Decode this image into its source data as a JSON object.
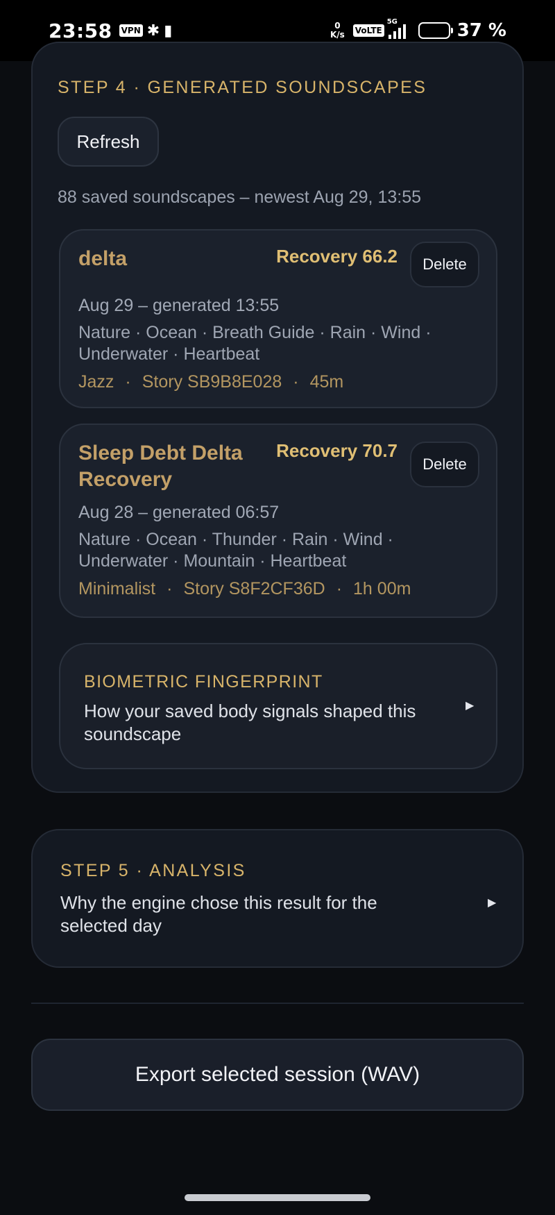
{
  "status_bar": {
    "time": "23:58",
    "vpn": "VPN",
    "speed_value": "0",
    "speed_unit": "K/s",
    "volte": "VoLTE",
    "network": "5G",
    "battery_percent": "37 %",
    "battery_level": 0.37
  },
  "step4": {
    "title": "STEP 4 · GENERATED SOUNDSCAPES",
    "refresh_label": "Refresh",
    "summary": "88 saved soundscapes – newest Aug 29, 13:55",
    "soundscapes": [
      {
        "title": "delta",
        "recovery": "Recovery 66.2",
        "delete_label": "Delete",
        "date": "Aug 29 – generated 13:55",
        "tags": "Nature · Ocean · Breath Guide · Rain · Wind · Underwater · Heartbeat",
        "genre": "Jazz",
        "story": "Story SB9B8E028",
        "duration": "45m"
      },
      {
        "title": "Sleep Debt Delta Recovery",
        "recovery": "Recovery 70.7",
        "delete_label": "Delete",
        "date": "Aug 28 – generated 06:57",
        "tags": "Nature · Ocean · Thunder · Rain · Wind · Underwater · Mountain · Heartbeat",
        "genre": "Minimalist",
        "story": "Story S8F2CF36D",
        "duration": "1h 00m"
      }
    ],
    "biometric": {
      "title": "BIOMETRIC FINGERPRINT",
      "description": "How your saved body signals shaped this soundscape"
    }
  },
  "step5": {
    "title": "STEP 5 · ANALYSIS",
    "description": "Why the engine chose this result for the selected day"
  },
  "export_label": "Export selected session (WAV)",
  "colors": {
    "accent_gold": "#d8b46a",
    "background": "#0b0d11",
    "card": "#141922"
  }
}
